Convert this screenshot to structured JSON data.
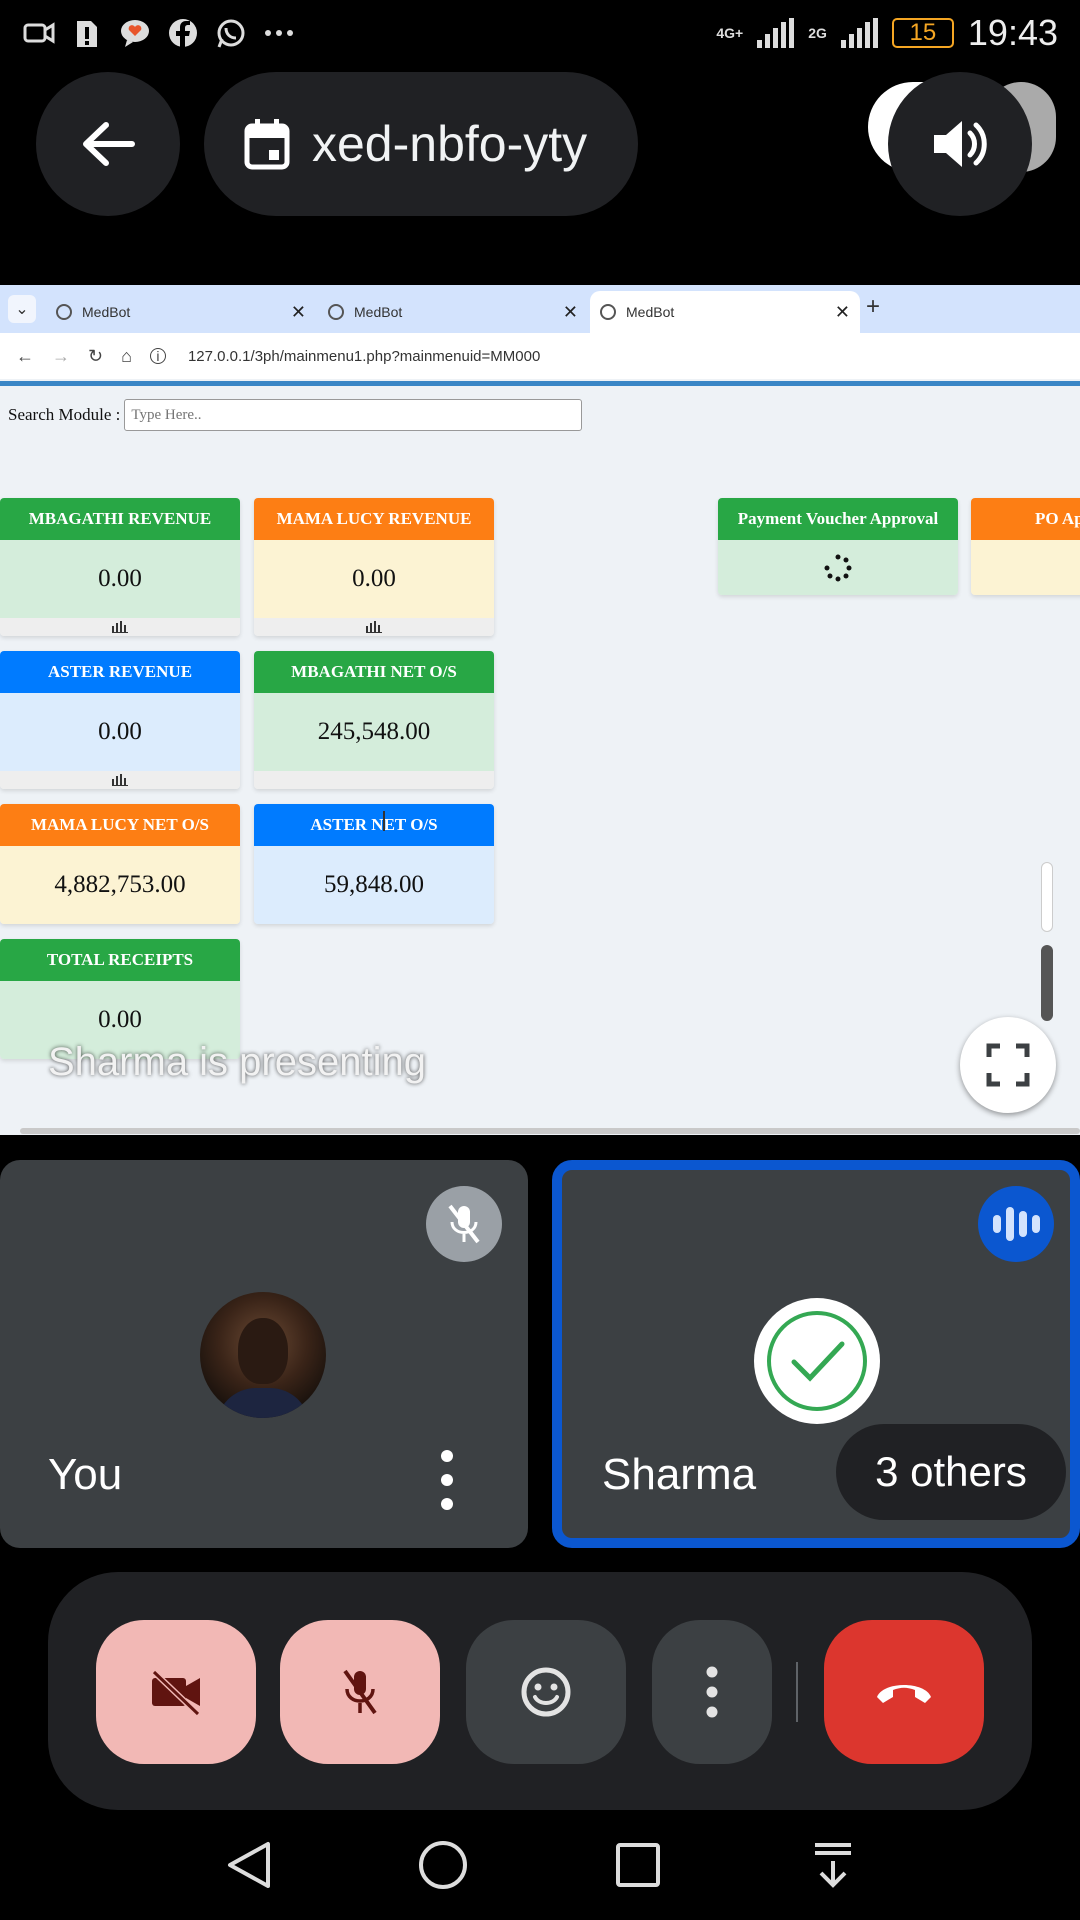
{
  "status_bar": {
    "network_1": "4G+",
    "network_2": "2G",
    "battery": "15",
    "time": "19:43"
  },
  "meet": {
    "meeting_code": "xed-nbfo-yty",
    "presenting_text": "Sharma is presenting",
    "self_name": "You",
    "participant_name": "Sharma",
    "others_label": "3 others"
  },
  "browser": {
    "tabs": [
      {
        "label": "MedBot"
      },
      {
        "label": "MedBot"
      },
      {
        "label": "MedBot"
      }
    ],
    "url": "127.0.0.1/3ph/mainmenu1.php?mainmenuid=MM000"
  },
  "page": {
    "search_label": "Search Module :",
    "search_placeholder": "Type Here..",
    "cards": [
      {
        "title": "MBAGATHI REVENUE",
        "value": "0.00"
      },
      {
        "title": "MAMA LUCY REVENUE",
        "value": "0.00"
      },
      {
        "title": "ASTER REVENUE",
        "value": "0.00"
      },
      {
        "title": "MBAGATHI NET O/S",
        "value": "245,548.00"
      },
      {
        "title": "MAMA LUCY NET O/S",
        "value": "4,882,753.00"
      },
      {
        "title": "ASTER NET O/S",
        "value": "59,848.00"
      },
      {
        "title": "TOTAL RECEIPTS",
        "value": "0.00"
      },
      {
        "title": "Payment Voucher Approval",
        "value": ""
      },
      {
        "title": "PO Ap",
        "value": ""
      }
    ]
  },
  "colors": {
    "green": "#28a745",
    "orange": "#fd7e14",
    "blue": "#007bff",
    "hangup": "#dc362e",
    "active_speaker": "#0b57d0"
  }
}
